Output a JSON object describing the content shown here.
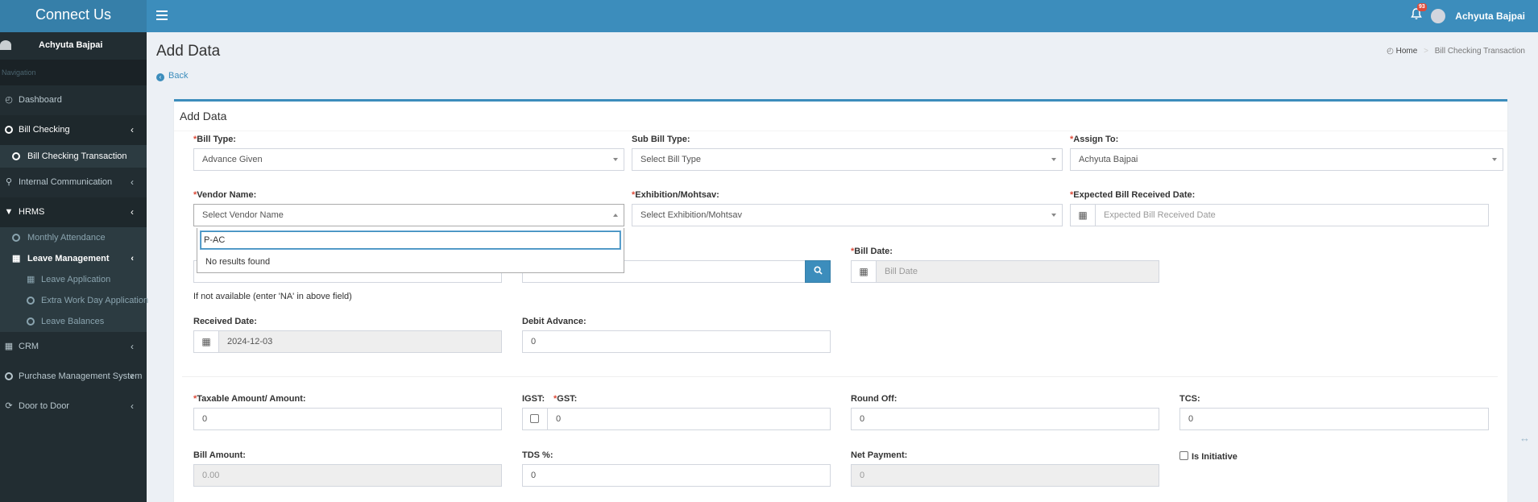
{
  "app": {
    "logo": "Connect Us",
    "user_name": "Achyuta Bajpai",
    "notification_count": "93"
  },
  "sidebar": {
    "user_name": "Achyuta Bajpai",
    "nav_header": "Navigation",
    "items": {
      "dashboard": "Dashboard",
      "bill_checking": "Bill Checking",
      "bill_checking_transaction": "Bill Checking Transaction",
      "internal_communication": "Internal Communication",
      "hrms": "HRMS",
      "monthly_attendance": "Monthly Attendance",
      "leave_management": "Leave Management",
      "leave_application": "Leave Application",
      "extra_work_day": "Extra Work Day Application",
      "leave_balances": "Leave Balances",
      "crm": "CRM",
      "purchase_management": "Purchase Management System",
      "door_to_door": "Door to Door"
    }
  },
  "page": {
    "title": "Add Data",
    "back": "Back"
  },
  "breadcrumb": {
    "home": "Home",
    "current": "Bill Checking Transaction"
  },
  "form": {
    "box_title": "Add Data",
    "bill_type": {
      "label": "Bill Type:",
      "value": "Advance Given"
    },
    "sub_bill_type": {
      "label": "Sub Bill Type:",
      "value": "Select Bill Type"
    },
    "assign_to": {
      "label": "Assign To:",
      "value": "Achyuta Bajpai"
    },
    "vendor_name": {
      "label": "Vendor Name:",
      "value": "Select Vendor Name",
      "search_text": "P-AC",
      "no_results": "No results found"
    },
    "exhibition": {
      "label": "Exhibition/Mohtsav:",
      "value": "Select Exhibition/Mohtsav"
    },
    "expected_bill_date": {
      "label": "Expected Bill Received Date:",
      "placeholder": "Expected Bill Received Date"
    },
    "bill_date": {
      "label": "Bill Date:",
      "placeholder": "Bill Date"
    },
    "na_help": "If not available (enter 'NA' in above field)",
    "received_date": {
      "label": "Received Date:",
      "value": "2024-12-03"
    },
    "debit_advance": {
      "label": "Debit Advance:",
      "value": "0"
    },
    "taxable_amount": {
      "label": "Taxable Amount/ Amount:",
      "value": "0"
    },
    "igst": {
      "label": "IGST:"
    },
    "gst": {
      "label": "GST:",
      "value": "0"
    },
    "round_off": {
      "label": "Round Off:",
      "value": "0"
    },
    "tcs": {
      "label": "TCS:",
      "value": "0"
    },
    "bill_amount": {
      "label": "Bill Amount:",
      "value": "0.00"
    },
    "tds": {
      "label": "TDS %:",
      "value": "0"
    },
    "net_payment": {
      "label": "Net Payment:",
      "value": "0"
    },
    "is_initiative": {
      "label": "Is Initiative"
    },
    "required_mark": "*"
  }
}
